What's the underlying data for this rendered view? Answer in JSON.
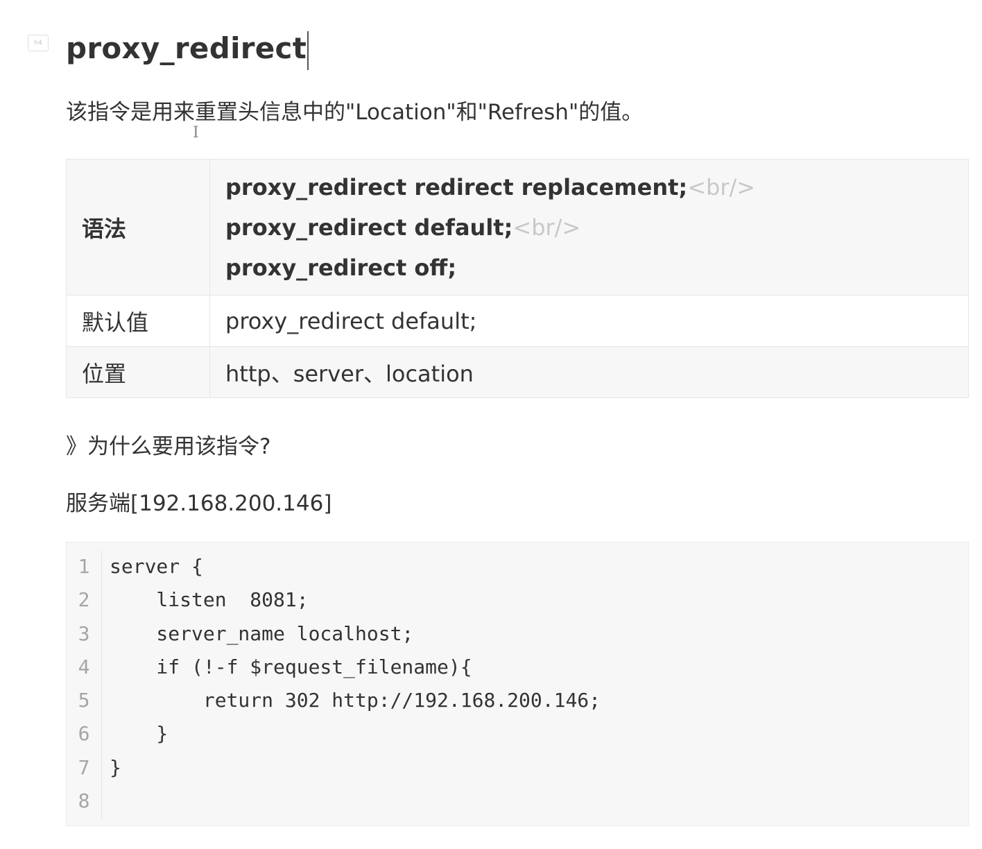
{
  "heading": {
    "marker": "h4",
    "title": "proxy_redirect"
  },
  "intro": "该指令是用来重置头信息中的\"Location\"和\"Refresh\"的值。",
  "table": {
    "syntax": {
      "label": "语法",
      "lines": [
        "proxy_redirect redirect replacement;",
        "proxy_redirect default;",
        "proxy_redirect off;"
      ],
      "br_tag": "<br/>"
    },
    "default": {
      "label": "默认值",
      "value": "proxy_redirect default;"
    },
    "location": {
      "label": "位置",
      "value": "http、server、location"
    }
  },
  "question": "》为什么要用该指令?",
  "server_caption": "服务端[192.168.200.146]",
  "code": {
    "line_numbers": [
      "1",
      "2",
      "3",
      "4",
      "5",
      "6",
      "7",
      "8"
    ],
    "lines": [
      "server {",
      "    listen  8081;",
      "    server_name localhost;",
      "    if (!-f $request_filename){",
      "        return 302 http://192.168.200.146;",
      "    }",
      "}",
      ""
    ]
  }
}
